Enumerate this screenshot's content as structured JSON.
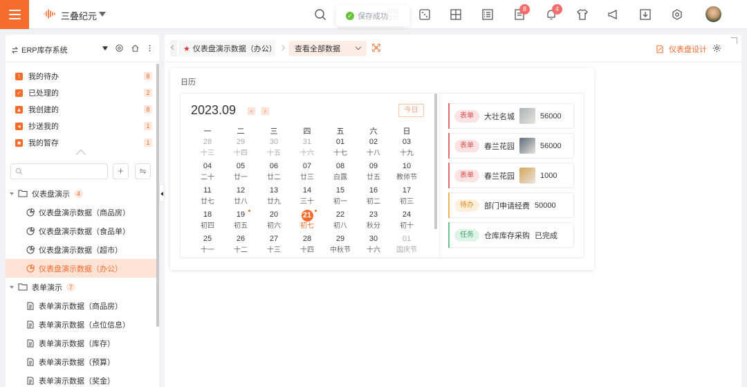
{
  "header": {
    "app_name": "三叠纪元",
    "toast": "保存成功",
    "badges": {
      "todo_count": "8",
      "bell_count": "4"
    }
  },
  "sidebar": {
    "system_title": "ERP库存系统",
    "todo": [
      {
        "label": "我的待办",
        "count": "8",
        "icon": "inbox-icon"
      },
      {
        "label": "已处理的",
        "count": "2",
        "icon": "check-icon"
      },
      {
        "label": "我创建的",
        "count": "8",
        "icon": "user-icon"
      },
      {
        "label": "抄送我的",
        "count": "1",
        "icon": "send-icon"
      },
      {
        "label": "我的暂存",
        "count": "1",
        "icon": "save-icon"
      }
    ],
    "search_placeholder": "",
    "groups": [
      {
        "label": "仪表盘演示",
        "count": "4",
        "items": [
          {
            "label": "仪表盘演示数据（商品房）",
            "active": false
          },
          {
            "label": "仪表盘演示数据（食品单）",
            "active": false
          },
          {
            "label": "仪表盘演示数据（超市）",
            "active": false
          },
          {
            "label": "仪表盘演示数据（办公）",
            "active": true
          }
        ]
      },
      {
        "label": "表单演示",
        "count": "7",
        "items": [
          {
            "label": "表单演示数据（商品房）"
          },
          {
            "label": "表单演示数据（点位信息）"
          },
          {
            "label": "表单演示数据（库存）"
          },
          {
            "label": "表单演示数据（预算）"
          },
          {
            "label": "表单演示数据（奖金）"
          }
        ]
      }
    ]
  },
  "tabs": {
    "active_tab": "仪表盘演示数据（办公）",
    "view_select": "查看全部数据",
    "design_label": "仪表盘设计"
  },
  "calendar": {
    "card_title": "日历",
    "month": "2023.09",
    "today_label": "今日",
    "prev": "‹",
    "next": "›",
    "weekdays": [
      "一",
      "二",
      "三",
      "四",
      "五",
      "六",
      "日"
    ],
    "weeks": [
      [
        [
          "28",
          "十三",
          1
        ],
        [
          "29",
          "十四",
          1
        ],
        [
          "30",
          "十五",
          1
        ],
        [
          "31",
          "十六",
          1
        ],
        [
          "01",
          "十七",
          0
        ],
        [
          "02",
          "十八",
          0
        ],
        [
          "03",
          "十九",
          0
        ]
      ],
      [
        [
          "04",
          "二十",
          0
        ],
        [
          "05",
          "廿一",
          0
        ],
        [
          "06",
          "廿二",
          0
        ],
        [
          "07",
          "廿三",
          0
        ],
        [
          "08",
          "白露",
          0
        ],
        [
          "09",
          "廿五",
          0
        ],
        [
          "10",
          "教师节",
          0
        ]
      ],
      [
        [
          "11",
          "廿七",
          0
        ],
        [
          "12",
          "廿八",
          0
        ],
        [
          "13",
          "廿九",
          0
        ],
        [
          "14",
          "三十",
          0
        ],
        [
          "15",
          "初一",
          0
        ],
        [
          "16",
          "初二",
          0
        ],
        [
          "17",
          "初三",
          0
        ]
      ],
      [
        [
          "18",
          "初四",
          0
        ],
        [
          "19",
          "初五",
          0
        ],
        [
          "20",
          "初六",
          0
        ],
        [
          "21",
          "初七",
          0
        ],
        [
          "22",
          "初八",
          0
        ],
        [
          "23",
          "秋分",
          0
        ],
        [
          "24",
          "初十",
          0
        ]
      ],
      [
        [
          "25",
          "十一",
          0
        ],
        [
          "26",
          "十二",
          0
        ],
        [
          "27",
          "十三",
          0
        ],
        [
          "28",
          "十四",
          0
        ],
        [
          "29",
          "中秋节",
          0
        ],
        [
          "30",
          "十六",
          0
        ],
        [
          "01",
          "国庆节",
          1
        ]
      ]
    ],
    "today": "21",
    "marked_days": [
      "19",
      "21"
    ],
    "events": [
      {
        "tag": "表单",
        "text": "大壮名城",
        "value": "56000",
        "thumb": true,
        "color": "#e86a6a",
        "tag_bg": "#fbe3e3",
        "tag_fg": "#d95050",
        "thumb_bg": "#a9b3b8"
      },
      {
        "tag": "表单",
        "text": "春兰花园",
        "value": "56000",
        "thumb": true,
        "color": "#e86a6a",
        "tag_bg": "#fbe3e3",
        "tag_fg": "#d95050",
        "thumb_bg": "#5a6b7d"
      },
      {
        "tag": "表单",
        "text": "春兰花园",
        "value": "1000",
        "thumb": true,
        "color": "#e86a6a",
        "tag_bg": "#fbe3e3",
        "tag_fg": "#d95050",
        "thumb_bg": "#d7a45c"
      },
      {
        "tag": "待办",
        "text": "部门申请经费",
        "value": "50000",
        "thumb": false,
        "color": "#f0b35a",
        "tag_bg": "#fdf0dc",
        "tag_fg": "#d98a1c",
        "thumb_bg": ""
      },
      {
        "tag": "任务",
        "text": "仓库库存采购",
        "value": "已完成",
        "thumb": false,
        "color": "#69c28f",
        "tag_bg": "#dff3e7",
        "tag_fg": "#3ba26a",
        "thumb_bg": ""
      }
    ]
  }
}
